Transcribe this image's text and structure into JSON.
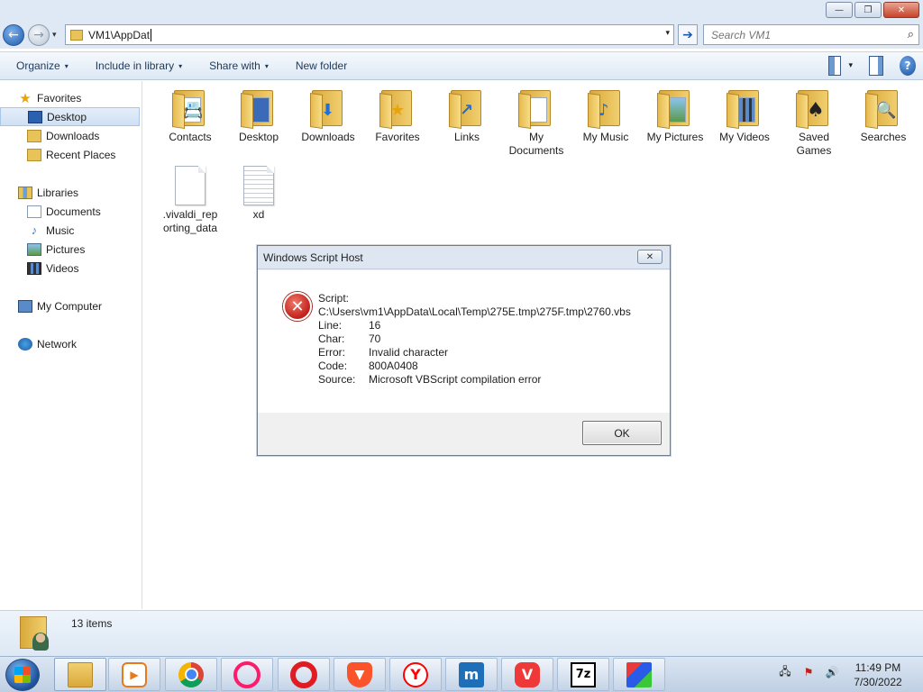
{
  "window": {
    "minimize_glyph": "—",
    "maximize_glyph": "❐",
    "close_glyph": "✕"
  },
  "address": {
    "back_glyph": "←",
    "forward_glyph": "→",
    "dropdown_glyph": "▾",
    "path": "VM1\\AppDat",
    "go_glyph": "➔",
    "search_placeholder": "Search VM1"
  },
  "toolbar": {
    "organize": "Organize",
    "include_in_library": "Include in library",
    "share_with": "Share with",
    "new_folder": "New folder",
    "dropdown_glyph": "▾",
    "help_glyph": "?"
  },
  "sidebar": {
    "favorites": "Favorites",
    "desktop": "Desktop",
    "downloads": "Downloads",
    "recent_places": "Recent Places",
    "libraries": "Libraries",
    "documents": "Documents",
    "music": "Music",
    "pictures": "Pictures",
    "videos": "Videos",
    "my_computer": "My Computer",
    "network": "Network"
  },
  "items": [
    {
      "label": "Contacts",
      "badge": "📇"
    },
    {
      "label": "Desktop",
      "badge": "🖥"
    },
    {
      "label": "Downloads",
      "badge": "⬇"
    },
    {
      "label": "Favorites",
      "badge": "★"
    },
    {
      "label": "Links",
      "badge": "↗"
    },
    {
      "label": "My Documents",
      "badge": "📄"
    },
    {
      "label": "My Music",
      "badge": "♪"
    },
    {
      "label": "My Pictures",
      "badge": "🖼"
    },
    {
      "label": "My Videos",
      "badge": "🎞"
    },
    {
      "label": "Saved Games",
      "badge": "♠"
    },
    {
      "label": "Searches",
      "badge": "🔍"
    },
    {
      "label": ".vivaldi_reporting_data",
      "label_line1": ".vivaldi_rep",
      "label_line2": "orting_data"
    },
    {
      "label": "xd"
    }
  ],
  "status": {
    "count": "13 items"
  },
  "dialog": {
    "title": "Windows Script Host",
    "close_glyph": "✕",
    "error_glyph": "✕",
    "script_label": "Script:",
    "script_path": "C:\\Users\\vm1\\AppData\\Local\\Temp\\275E.tmp\\275F.tmp\\2760.vbs",
    "line_label": "Line:",
    "line_value": "16",
    "char_label": "Char:",
    "char_value": "70",
    "error_label": "Error:",
    "error_value": "Invalid character",
    "code_label": "Code:",
    "code_value": "800A0408",
    "source_label": "Source:",
    "source_value": "Microsoft VBScript compilation error",
    "ok_label": "OK"
  },
  "taskbar": {
    "media_glyph": "▶",
    "brave_glyph": "▼",
    "yandex_glyph": "Y",
    "maxthon_glyph": "m",
    "vivaldi_glyph": "V",
    "sevenzip_glyph": "7z",
    "clock_time": "11:49 PM",
    "clock_date": "7/30/2022",
    "tray_network_glyph": "🖧",
    "tray_flag_glyph": "⚑",
    "tray_volume_glyph": "🔊"
  }
}
